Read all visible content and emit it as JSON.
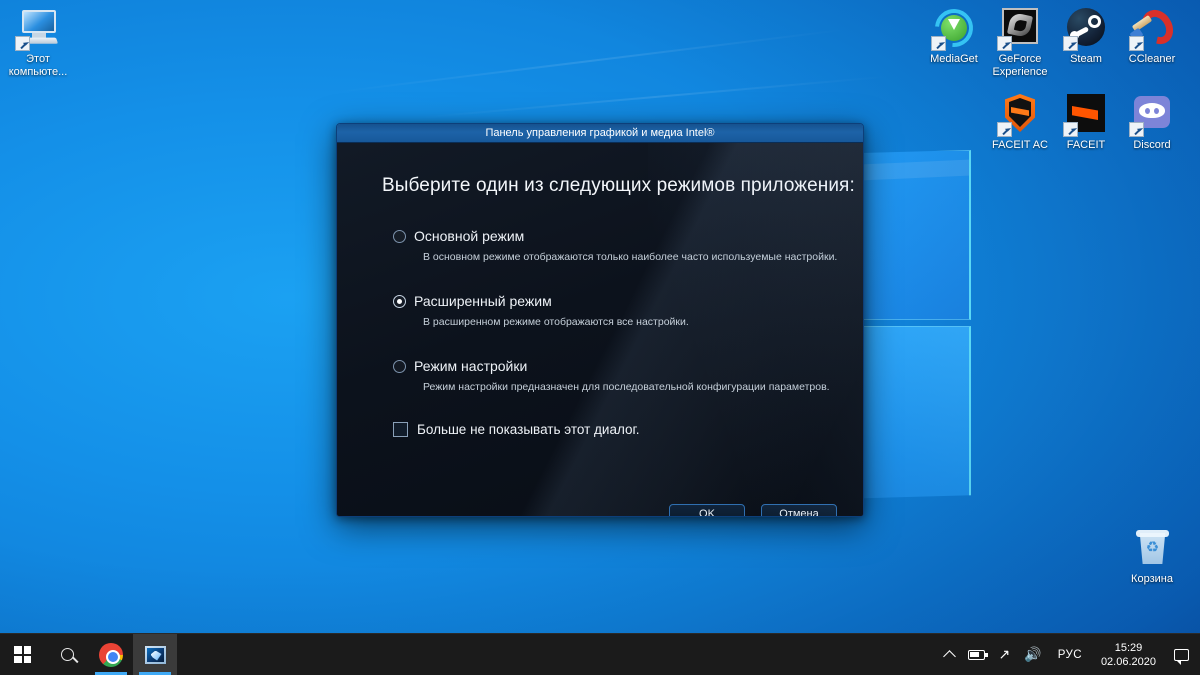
{
  "desktop": {
    "icons_left": [
      {
        "name": "this-pc",
        "label": "Этот\nкомпьюте...",
        "label_line1": "Этот",
        "label_line2": "компьюте..."
      }
    ],
    "icons_right_row1": [
      {
        "name": "mediaget",
        "label": "MediaGet"
      },
      {
        "name": "geforce-experience",
        "label_line1": "GeForce",
        "label_line2": "Experience"
      },
      {
        "name": "steam",
        "label": "Steam"
      },
      {
        "name": "ccleaner",
        "label": "CCleaner"
      }
    ],
    "icons_right_row2": [
      {
        "name": "faceit-ac",
        "label": "FACEIT AC"
      },
      {
        "name": "faceit",
        "label": "FACEIT"
      },
      {
        "name": "discord",
        "label": "Discord"
      }
    ],
    "recycle_bin": {
      "label": "Корзина"
    }
  },
  "dialog": {
    "title": "Панель управления графикой и медиа Intel®",
    "heading": "Выберите один из следующих режимов приложения:",
    "options": [
      {
        "label": "Основной режим",
        "description": "В основном режиме отображаются только наиболее часто используемые настройки.",
        "selected": false
      },
      {
        "label": "Расширенный режим",
        "description": "В расширенном режиме отображаются все настройки.",
        "selected": true
      },
      {
        "label": "Режим настройки",
        "description": "Режим настройки предназначен для последовательной конфигурации параметров.",
        "selected": false
      }
    ],
    "checkbox": {
      "label": "Больше не показывать этот диалог.",
      "checked": false
    },
    "buttons": {
      "ok": "OK",
      "cancel": "Отмена"
    },
    "colors": {
      "titlebar": "#1d63a8",
      "body": "#0c121c",
      "accent": "#2f6fb0"
    }
  },
  "taskbar": {
    "start": {
      "icon": "windows-logo-icon"
    },
    "search": {
      "icon": "search-icon"
    },
    "apps": [
      {
        "name": "chrome",
        "icon": "chrome-icon",
        "running": true,
        "active": false
      },
      {
        "name": "intel-graphics",
        "icon": "intel-graphics-icon",
        "running": true,
        "active": true
      }
    ],
    "tray": {
      "overflow": "show-hidden-icons",
      "battery": "battery-icon",
      "network": "wifi-icon",
      "volume": "volume-icon",
      "language": "РУС",
      "time": "15:29",
      "date": "02.06.2020",
      "action_center": "action-center-icon"
    }
  }
}
